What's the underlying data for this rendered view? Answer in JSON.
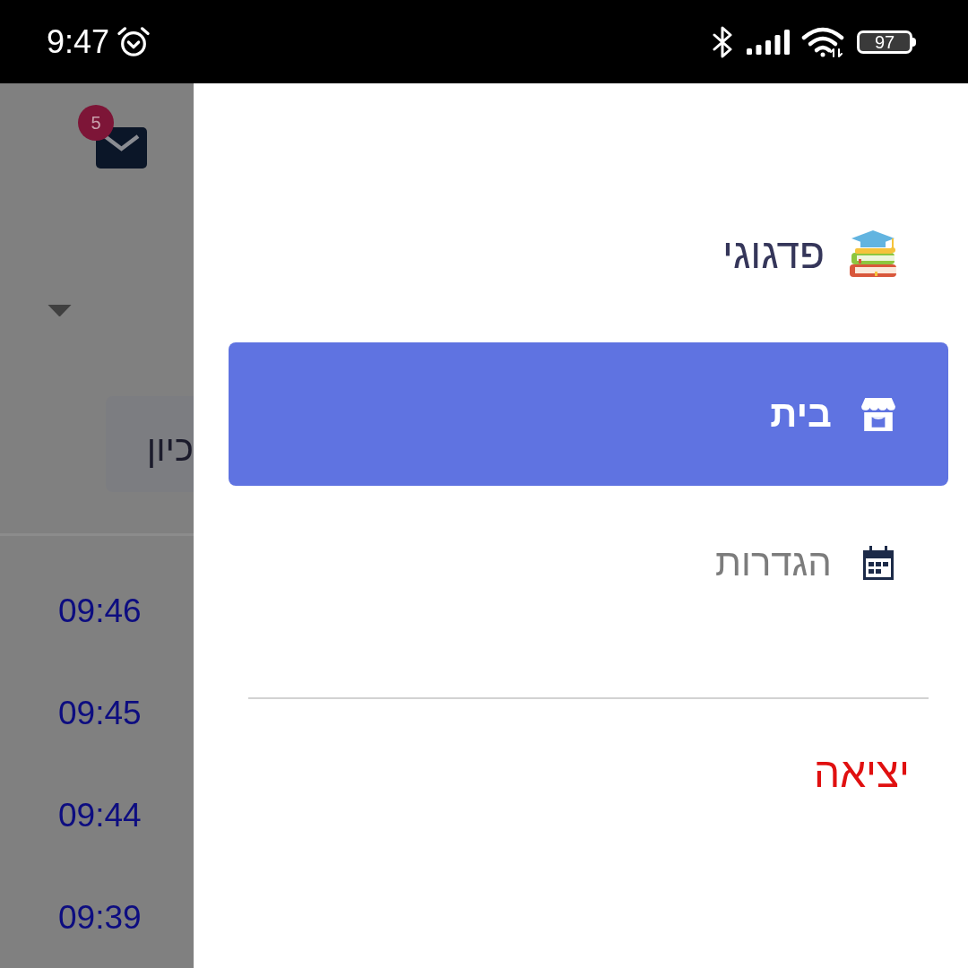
{
  "status_bar": {
    "time": "9:47",
    "battery": "97"
  },
  "background_page": {
    "message_badge": "5",
    "card_text": "כיון",
    "times": [
      "09:46",
      "09:45",
      "09:44",
      "09:39"
    ]
  },
  "drawer": {
    "brand": "פדגוגי",
    "items": [
      {
        "label": "בית",
        "kind": "store",
        "selected": true
      },
      {
        "label": "הגדרות",
        "kind": "calendar",
        "selected": false
      }
    ],
    "logout": "יציאה"
  }
}
